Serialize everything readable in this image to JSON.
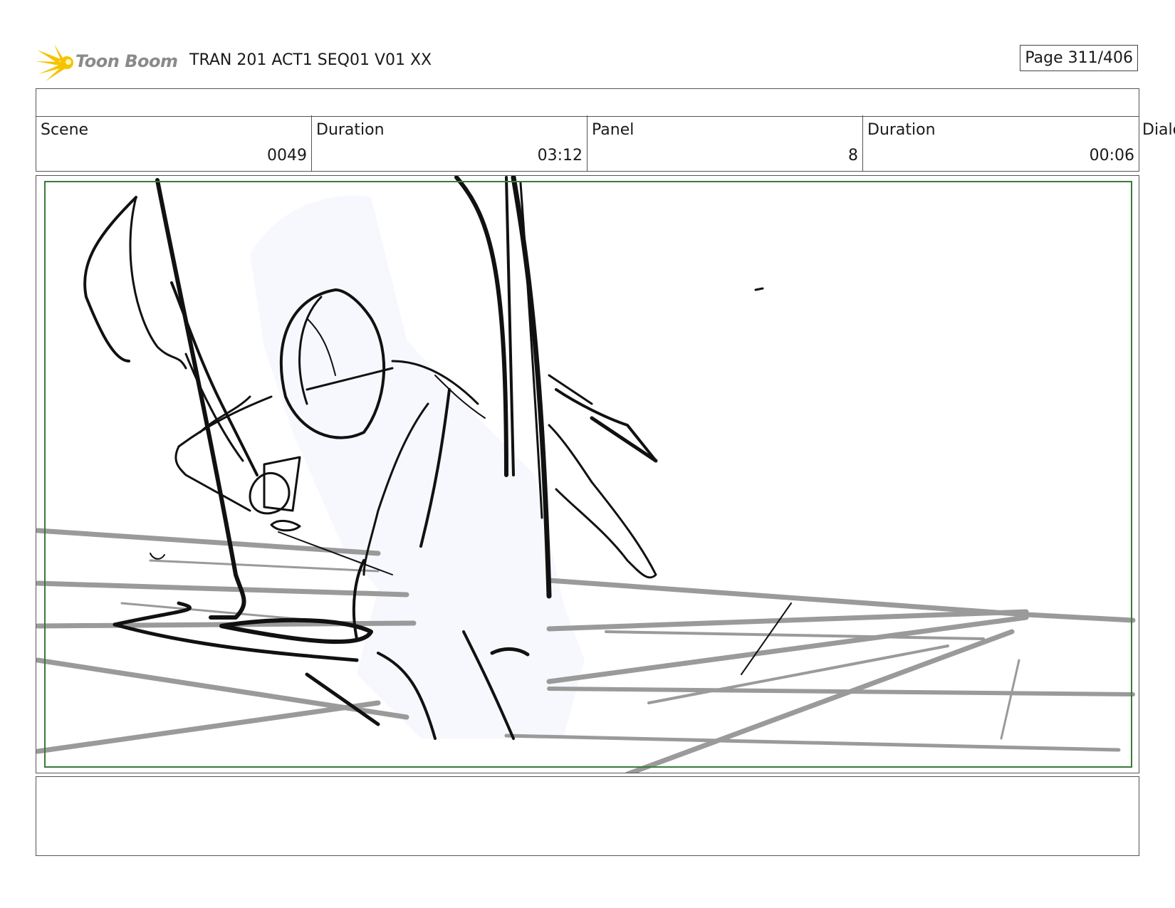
{
  "header": {
    "logo_text": "Toon Boom",
    "doc_title": "TRAN 201 ACT1 SEQ01 V01 XX",
    "page_label": "Page 311/406"
  },
  "info": {
    "scene_label": "Scene",
    "scene_value": "0049",
    "scene_duration_label": "Duration",
    "scene_duration_value": "03:12",
    "panel_label": "Panel",
    "panel_value": "8",
    "panel_duration_label": "Duration",
    "panel_duration_value": "00:06",
    "dialog_label": "Dialo"
  },
  "colors": {
    "safe_frame": "#3a7a3a",
    "logo_star": "#f5c400",
    "sketch_fill": "#f6f8fd",
    "grey_lines": "#9a9a9a"
  }
}
